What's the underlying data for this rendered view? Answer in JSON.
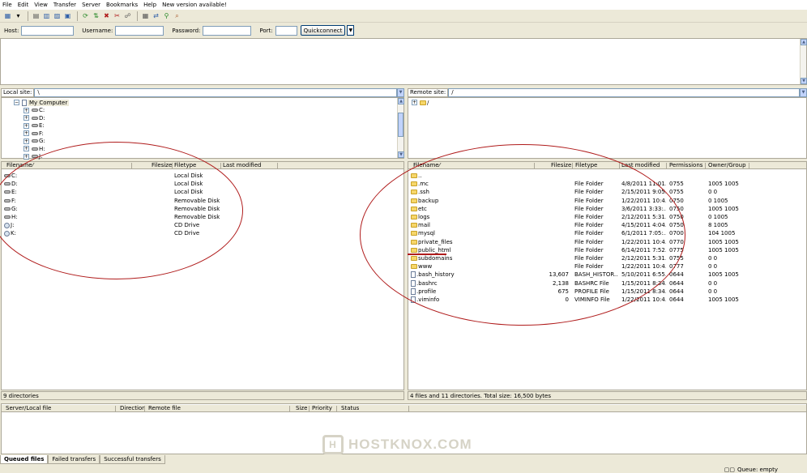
{
  "menu": [
    "File",
    "Edit",
    "View",
    "Transfer",
    "Server",
    "Bookmarks",
    "Help",
    "New version available!"
  ],
  "toolbar_icons": [
    "site-manager-icon",
    "dropdown-icon",
    "message-log-icon",
    "local-tree-icon",
    "remote-tree-icon",
    "queue-icon",
    "refresh-icon",
    "process-queue-icon",
    "cancel-icon",
    "disconnect-icon",
    "reconnect-icon",
    "compare-icon",
    "sync-browse-icon",
    "filter-icon",
    "search-icon"
  ],
  "quickconnect": {
    "host_label": "Host:",
    "username_label": "Username:",
    "password_label": "Password:",
    "port_label": "Port:",
    "button_label": "Quickconnect",
    "host": "",
    "username": "",
    "password": "",
    "port": ""
  },
  "local": {
    "site_label": "Local site:",
    "path": "\\",
    "tree": [
      {
        "label": "My Computer",
        "root": true
      },
      {
        "label": "C:"
      },
      {
        "label": "D:"
      },
      {
        "label": "E:"
      },
      {
        "label": "F:"
      },
      {
        "label": "G:"
      },
      {
        "label": "H:"
      },
      {
        "label": "J:"
      }
    ],
    "columns": {
      "filename": "Filename",
      "filesize": "Filesize",
      "filetype": "Filetype",
      "modified": "Last modified"
    },
    "files": [
      {
        "name": "C:",
        "type": "Local Disk",
        "icon": "drive"
      },
      {
        "name": "D:",
        "type": "Local Disk",
        "icon": "drive"
      },
      {
        "name": "E:",
        "type": "Local Disk",
        "icon": "drive"
      },
      {
        "name": "F:",
        "type": "Removable Disk",
        "icon": "drive"
      },
      {
        "name": "G:",
        "type": "Removable Disk",
        "icon": "drive"
      },
      {
        "name": "H:",
        "type": "Removable Disk",
        "icon": "drive"
      },
      {
        "name": "J:",
        "type": "CD Drive",
        "icon": "cd"
      },
      {
        "name": "K:",
        "type": "CD Drive",
        "icon": "cd"
      }
    ],
    "status": "9 directories"
  },
  "remote": {
    "site_label": "Remote site:",
    "path": "/",
    "tree_root": "/",
    "columns": {
      "filename": "Filename",
      "filesize": "Filesize",
      "filetype": "Filetype",
      "modified": "Last modified",
      "permissions": "Permissions",
      "owner": "Owner/Group"
    },
    "files": [
      {
        "name": "..",
        "size": "",
        "type": "",
        "modified": "",
        "perm": "",
        "owner": "",
        "icon": "folder"
      },
      {
        "name": ".mc",
        "size": "",
        "type": "File Folder",
        "modified": "4/8/2011 11:01...",
        "perm": "0755",
        "owner": "1005 1005",
        "icon": "folder"
      },
      {
        "name": ".ssh",
        "size": "",
        "type": "File Folder",
        "modified": "2/15/2011 9:05...",
        "perm": "0755",
        "owner": "0 0",
        "icon": "folder"
      },
      {
        "name": "backup",
        "size": "",
        "type": "File Folder",
        "modified": "1/22/2011 10:4...",
        "perm": "0750",
        "owner": "0 1005",
        "icon": "folder"
      },
      {
        "name": "etc",
        "size": "",
        "type": "File Folder",
        "modified": "3/6/2011 3:33:...",
        "perm": "0750",
        "owner": "1005 1005",
        "icon": "folder"
      },
      {
        "name": "logs",
        "size": "",
        "type": "File Folder",
        "modified": "2/12/2011 5:31...",
        "perm": "0750",
        "owner": "0 1005",
        "icon": "folder"
      },
      {
        "name": "mail",
        "size": "",
        "type": "File Folder",
        "modified": "4/15/2011 4:04...",
        "perm": "0750",
        "owner": "8 1005",
        "icon": "folder"
      },
      {
        "name": "mysql",
        "size": "",
        "type": "File Folder",
        "modified": "6/1/2011 7:05:...",
        "perm": "0700",
        "owner": "104 1005",
        "icon": "folder"
      },
      {
        "name": "private_files",
        "size": "",
        "type": "File Folder",
        "modified": "1/22/2011 10:4...",
        "perm": "0770",
        "owner": "1005 1005",
        "icon": "folder"
      },
      {
        "name": "public_html",
        "size": "",
        "type": "File Folder",
        "modified": "6/14/2011 7:52...",
        "perm": "0775",
        "owner": "1005 1005",
        "icon": "folder"
      },
      {
        "name": "subdomains",
        "size": "",
        "type": "File Folder",
        "modified": "2/12/2011 5:31...",
        "perm": "0755",
        "owner": "0 0",
        "icon": "folder"
      },
      {
        "name": "www",
        "size": "",
        "type": "File Folder",
        "modified": "1/22/2011 10:4...",
        "perm": "0777",
        "owner": "0 0",
        "icon": "folder"
      },
      {
        "name": ".bash_history",
        "size": "13,607",
        "type": "BASH_HISTOR...",
        "modified": "5/10/2011 6:55...",
        "perm": "0644",
        "owner": "1005 1005",
        "icon": "file"
      },
      {
        "name": ".bashrc",
        "size": "2,138",
        "type": "BASHRC File",
        "modified": "1/15/2011 8:34...",
        "perm": "0644",
        "owner": "0 0",
        "icon": "file"
      },
      {
        "name": ".profile",
        "size": "675",
        "type": "PROFILE File",
        "modified": "1/15/2011 8:34...",
        "perm": "0644",
        "owner": "0 0",
        "icon": "file"
      },
      {
        "name": ".viminfo",
        "size": "0",
        "type": "VIMINFO File",
        "modified": "1/22/2011 10:4...",
        "perm": "0644",
        "owner": "1005 1005",
        "icon": "file"
      }
    ],
    "status": "4 files and 11 directories. Total size: 16,500 bytes"
  },
  "queue": {
    "columns": {
      "server": "Server/Local file",
      "direction": "Direction",
      "remote": "Remote file",
      "size": "Size",
      "priority": "Priority",
      "status": "Status"
    },
    "tabs": [
      "Queued files",
      "Failed transfers",
      "Successful transfers"
    ],
    "status": "Queue: empty"
  },
  "watermark": "HOSTKNOX.COM",
  "colors": {
    "annotation": "#b01c1c",
    "folder": "#f6d66a",
    "accent": "#316ac5"
  }
}
